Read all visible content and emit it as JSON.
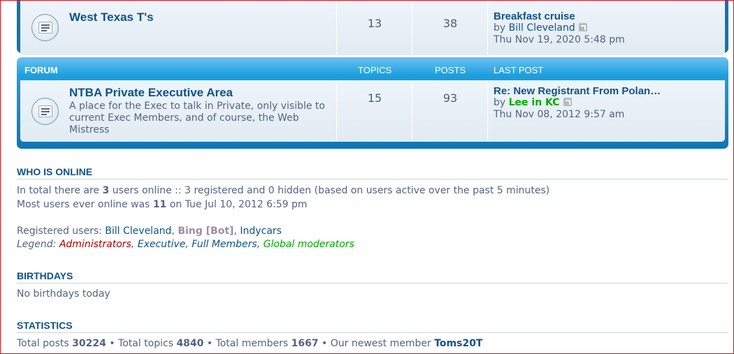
{
  "forums": [
    {
      "title": "West Texas T's",
      "description": "",
      "topics": "13",
      "posts": "38",
      "last_post": {
        "title": "Breakfast cruise",
        "by": "by",
        "user": "Bill Cleveland",
        "date": "Thu Nov 19, 2020 5:48 pm"
      }
    },
    {
      "title": "NTBA Private Executive Area",
      "description": "A place for the Exec to talk in Private, only visible to current Exec Members, and of course, the Web Mistress",
      "topics": "15",
      "posts": "93",
      "last_post": {
        "title": "Re: New Registrant From Polan…",
        "by": "by",
        "user": "Lee in KC",
        "user_color": "#00aa00",
        "date": "Thu Nov 08, 2012 9:57 am"
      }
    }
  ],
  "header": {
    "forum": "FORUM",
    "topics": "TOPICS",
    "posts": "POSTS",
    "last_post": "LAST POST"
  },
  "who_is_online": {
    "heading": "WHO IS ONLINE",
    "line1_a": "In total there are ",
    "line1_count": "3",
    "line1_b": " users online :: 3 registered and 0 hidden (based on users active over the past 5 minutes)",
    "line2_a": "Most users ever online was ",
    "line2_count": "11",
    "line2_b": " on Tue Jul 10, 2012 6:59 pm",
    "registered_label": "Registered users: ",
    "users": [
      "Bill Cleveland",
      "Bing [Bot]",
      "Indycars"
    ],
    "legend_label": "Legend: ",
    "legend": [
      "Administrators",
      "Executive",
      "Full Members",
      "Global moderators"
    ]
  },
  "birthdays": {
    "heading": "BIRTHDAYS",
    "text": "No birthdays today"
  },
  "statistics": {
    "heading": "STATISTICS",
    "posts_label": "Total posts ",
    "posts": "30224",
    "topics_label": " • Total topics ",
    "topics": "4840",
    "members_label": " • Total members ",
    "members": "1667",
    "newest_label": " • Our newest member ",
    "newest": "Toms20T"
  },
  "colors": {
    "panel_blue": "#0f75b4",
    "link_blue": "#105289",
    "admin_red": "#aa0000",
    "global_green": "#00aa00"
  }
}
